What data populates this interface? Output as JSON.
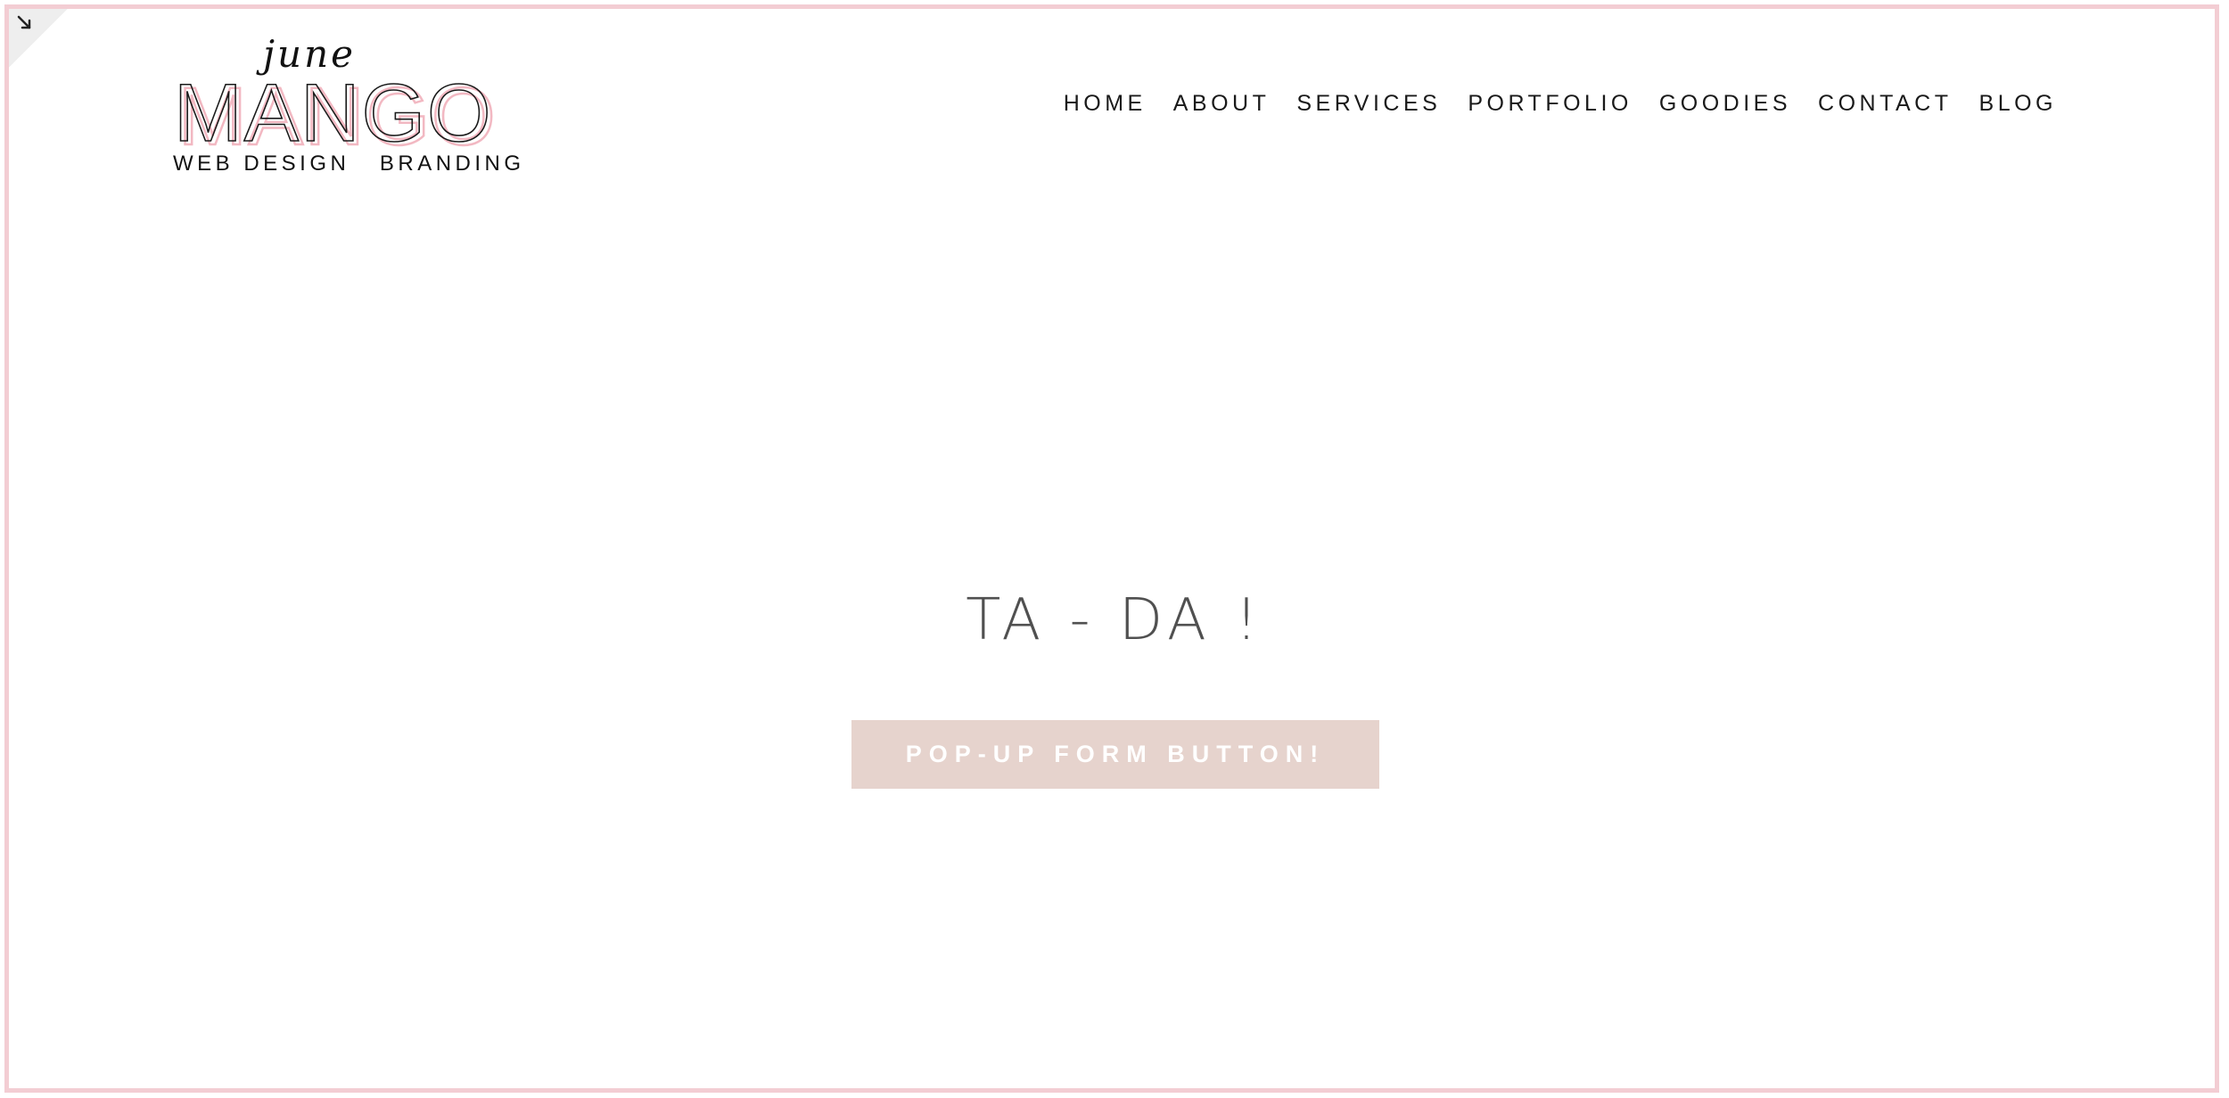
{
  "site": {
    "logo": {
      "script": "june",
      "wordmark": "MANGO",
      "tagline": "WEB DESIGN   BRANDING"
    },
    "nav": [
      {
        "label": "HOME"
      },
      {
        "label": "ABOUT"
      },
      {
        "label": "SERVICES"
      },
      {
        "label": "PORTFOLIO"
      },
      {
        "label": "GOODIES"
      },
      {
        "label": "CONTACT"
      },
      {
        "label": "BLOG"
      }
    ]
  },
  "hero": {
    "title": "TA - DA !",
    "button_label": "POP-UP FORM BUTTON!"
  },
  "icons": {
    "corner": "arrow-down-right-icon"
  },
  "colors": {
    "frame_border": "#f3cdd3",
    "button_bg": "#e6d3cd",
    "logo_accent": "#f2b8c2",
    "title_text": "#505050"
  }
}
